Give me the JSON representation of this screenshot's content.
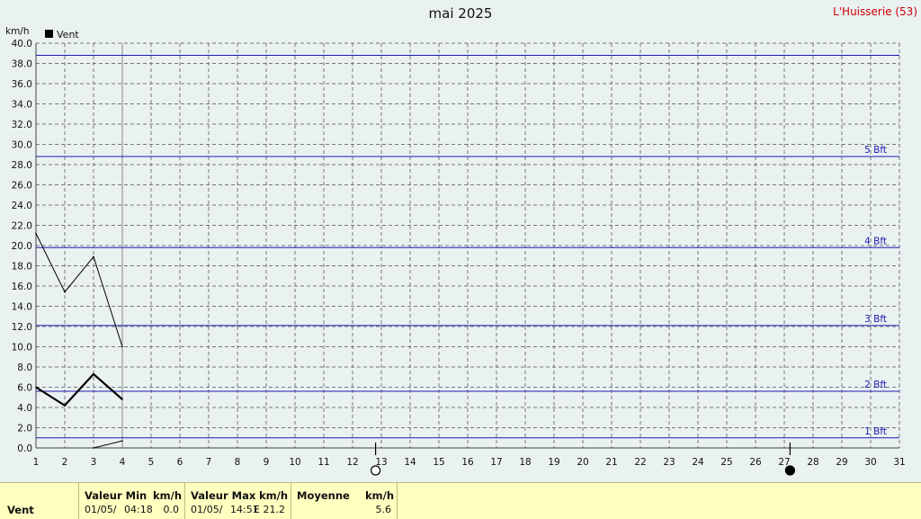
{
  "title": "mai 2025",
  "station": "L'Huisserie (53)",
  "legend": {
    "label": "Vent",
    "color": "#000000"
  },
  "chart_data": {
    "type": "line",
    "ylabel": "km/h",
    "ylim": [
      0,
      40
    ],
    "xlim": [
      1,
      31
    ],
    "x_ticks": [
      "1",
      "2",
      "3",
      "4",
      "5",
      "6",
      "7",
      "8",
      "9",
      "10",
      "11",
      "12",
      "13",
      "14",
      "15",
      "16",
      "17",
      "18",
      "19",
      "20",
      "21",
      "22",
      "23",
      "24",
      "25",
      "26",
      "27",
      "28",
      "29",
      "30",
      "31"
    ],
    "y_ticks": [
      "0.0",
      "2.0",
      "4.0",
      "6.0",
      "8.0",
      "10.0",
      "12.0",
      "14.0",
      "16.0",
      "18.0",
      "20.0",
      "22.0",
      "24.0",
      "26.0",
      "28.0",
      "30.0",
      "32.0",
      "34.0",
      "36.0",
      "38.0",
      "40.0"
    ],
    "grid": true,
    "series": [
      {
        "role": "max",
        "color": "#000000",
        "x": [
          1,
          2,
          3,
          4
        ],
        "values": [
          21.2,
          15.4,
          18.9,
          10.0
        ]
      },
      {
        "role": "mean",
        "color": "#000000",
        "x": [
          1,
          2,
          3,
          4
        ],
        "values": [
          6.0,
          4.2,
          7.3,
          4.8
        ]
      },
      {
        "role": "min",
        "color": "#000000",
        "x": [
          3,
          4
        ],
        "values": [
          0.0,
          0.7
        ]
      }
    ],
    "beaufort_lines": [
      {
        "label": "1 Bft",
        "value": 1.0
      },
      {
        "label": "2 Bft",
        "value": 5.6
      },
      {
        "label": "3 Bft",
        "value": 12.1
      },
      {
        "label": "4 Bft",
        "value": 19.8
      },
      {
        "label": "5 Bft",
        "value": 28.8
      },
      {
        "label": "",
        "value": 38.8
      }
    ],
    "beaufort_color": "#1a1ab4",
    "current_day": 4,
    "moon_phases": [
      {
        "day": 12.8,
        "phase": "full"
      },
      {
        "day": 27.2,
        "phase": "new"
      }
    ]
  },
  "stats": {
    "row_label": "Vent",
    "min": {
      "header": "Valeur Min",
      "unit": "km/h",
      "date": "01/05/",
      "time": "04:18",
      "value": "0.0"
    },
    "max": {
      "header": "Valeur Max",
      "unit": "km/h",
      "date": "01/05/",
      "time": "14:51",
      "dir_value": "E 21.2"
    },
    "mean": {
      "header": "Moyenne",
      "unit": "km/h",
      "value": "5.6"
    }
  }
}
